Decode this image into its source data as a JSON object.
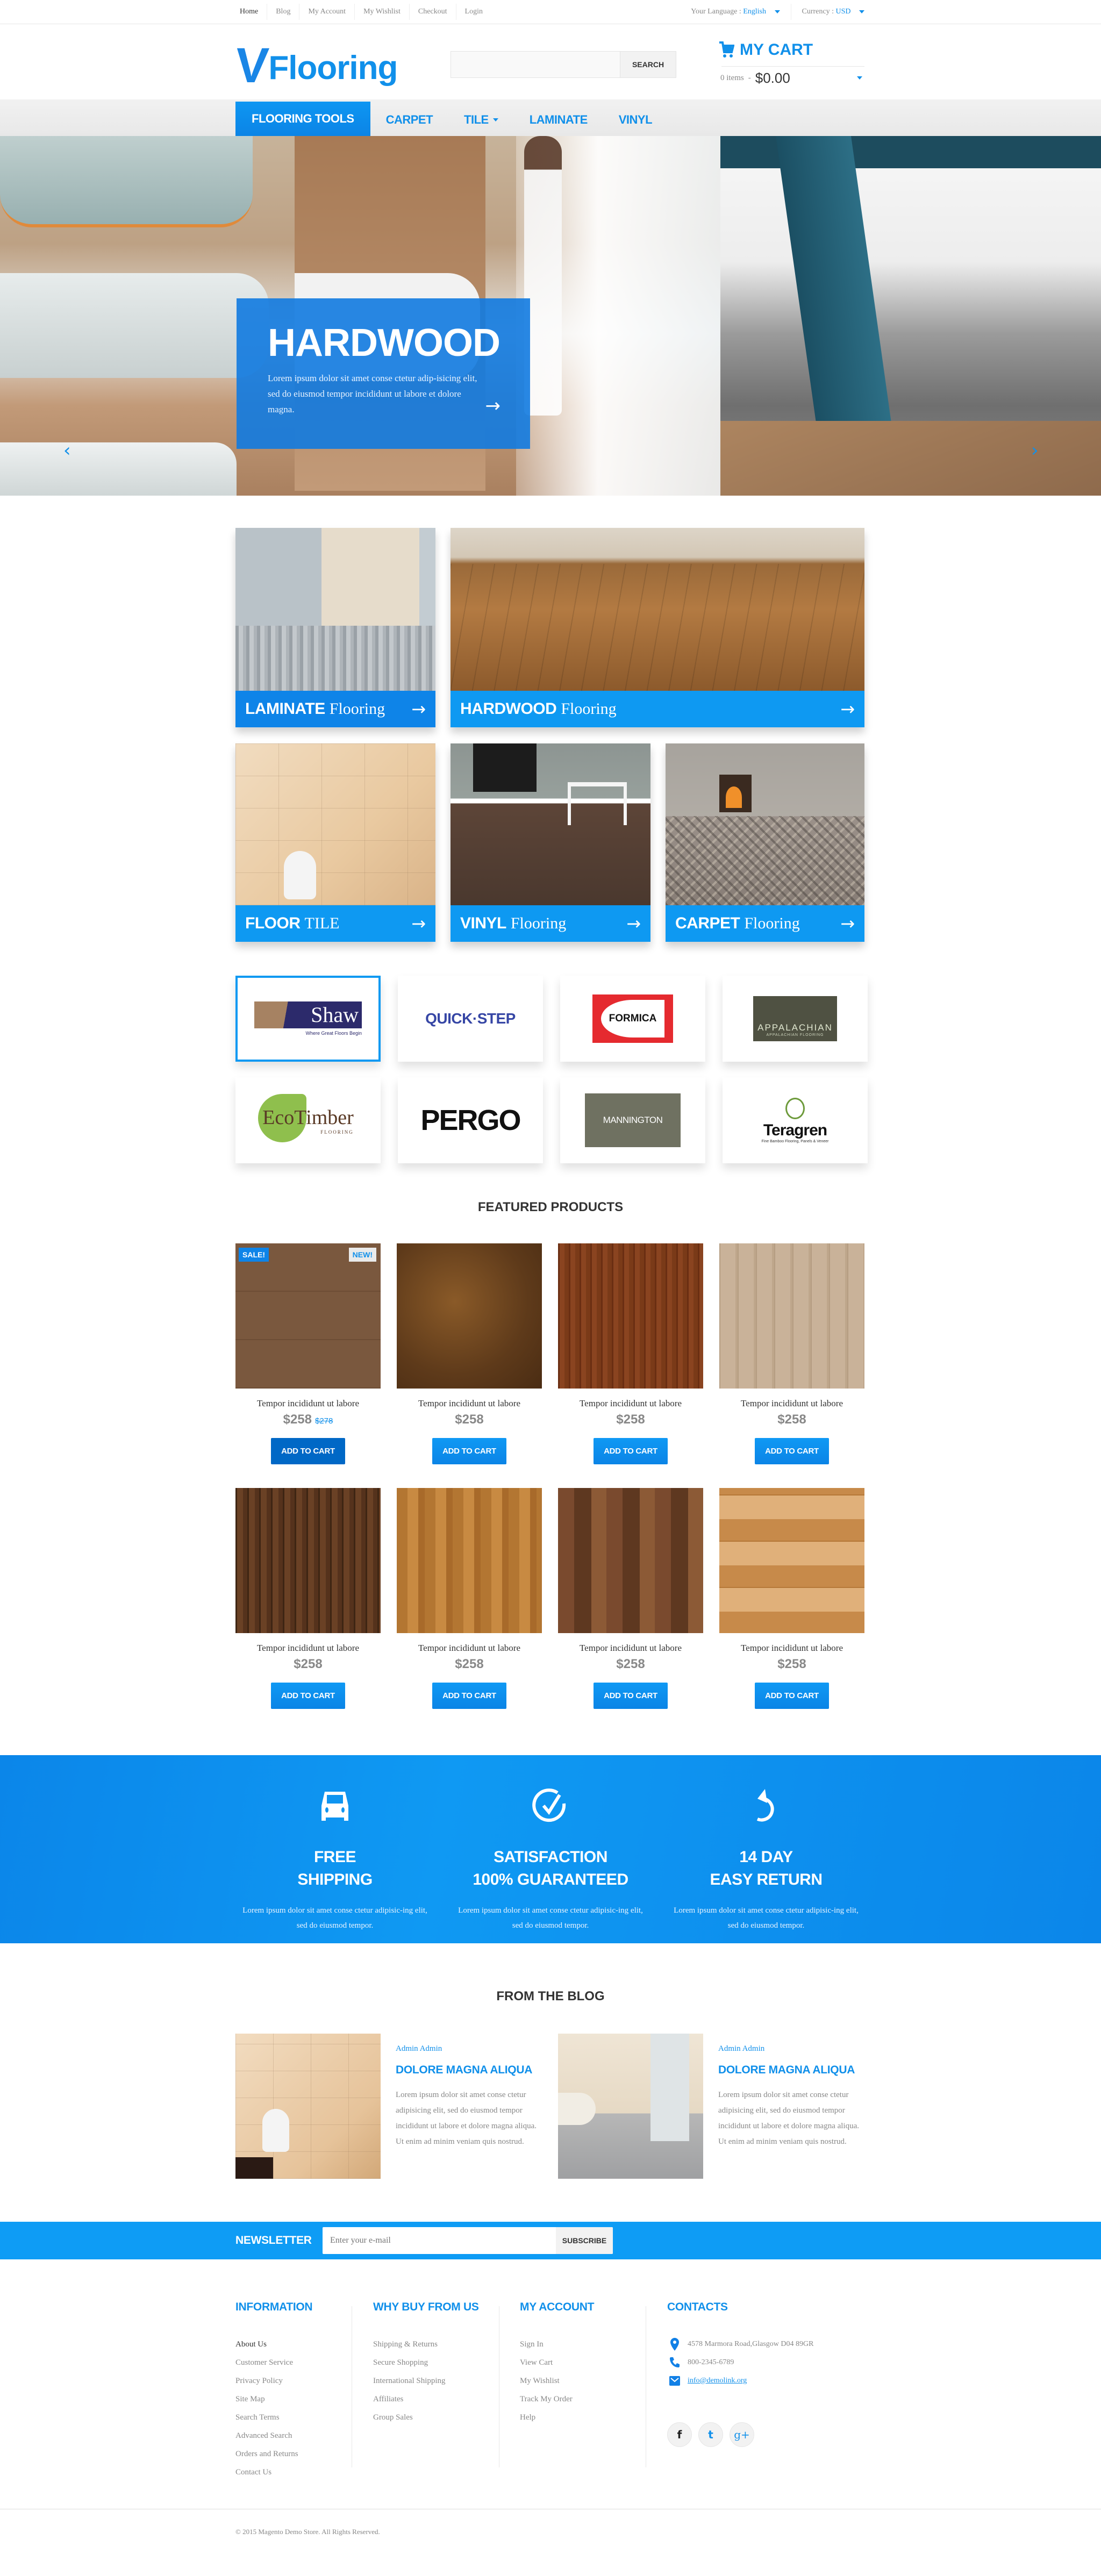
{
  "topbar": {
    "links": [
      "Home",
      "Blog",
      "My Account",
      "My Wishlist",
      "Checkout",
      "Login"
    ],
    "language_label": "Your Language :",
    "language_value": "English",
    "currency_label": "Currency :",
    "currency_value": "USD"
  },
  "header": {
    "logo_mark": "V",
    "logo_word": "Flooring",
    "search_placeholder": "",
    "search_button": "SEARCH",
    "cart_title": "MY CART",
    "cart_items": "0 items",
    "cart_separator": "-",
    "cart_total": "$0.00"
  },
  "nav": {
    "items": [
      {
        "label": "FLOORING TOOLS",
        "active": true
      },
      {
        "label": "CARPET",
        "active": false
      },
      {
        "label": "TILE",
        "active": false,
        "has_dropdown": true
      },
      {
        "label": "LAMINATE",
        "active": false
      },
      {
        "label": "VINYL",
        "active": false
      }
    ]
  },
  "hero": {
    "title": "HARDWOOD",
    "text": "Lorem ipsum dolor sit amet conse ctetur adip-isicing elit, sed do eiusmod tempor incididunt ut labore et dolore magna.",
    "prev_icon": "chevron-left",
    "next_icon": "chevron-right",
    "go_icon": "arrow-right"
  },
  "categories": [
    {
      "bold": "LAMINATE",
      "normal": "Flooring"
    },
    {
      "bold": "HARDWOOD",
      "normal": "Flooring"
    },
    {
      "bold": "FLOOR",
      "normal": "TILE"
    },
    {
      "bold": "VINYL",
      "normal": "Flooring"
    },
    {
      "bold": "CARPET",
      "normal": "Flooring"
    }
  ],
  "brands": [
    {
      "name": "Shaw",
      "tagline": "Where Great Floors Begin",
      "selected": true
    },
    {
      "name": "QUICK·STEP",
      "selected": false
    },
    {
      "name": "FORMICA",
      "selected": false
    },
    {
      "name": "APPALACHIAN",
      "tagline": "APPALACHIAN FLOORING",
      "selected": false
    },
    {
      "name": "EcoTimber",
      "tagline": "FLOORING",
      "selected": false
    },
    {
      "name": "PERGO",
      "selected": false
    },
    {
      "name": "MANNINGTON",
      "selected": false
    },
    {
      "name": "Teragren",
      "tagline": "Fine Bamboo Flooring, Panels & Veneer",
      "selected": false
    }
  ],
  "featured": {
    "title": "FEATURED PRODUCTS",
    "add_to_cart": "ADD TO CART",
    "products": [
      {
        "name": "Tempor incididunt ut labore",
        "price": "$258",
        "old_price": "$278",
        "sale_badge": "SALE!",
        "new_badge": "NEW!"
      },
      {
        "name": "Tempor incididunt ut labore",
        "price": "$258"
      },
      {
        "name": "Tempor incididunt ut labore",
        "price": "$258"
      },
      {
        "name": "Tempor incididunt ut labore",
        "price": "$258"
      },
      {
        "name": "Tempor incididunt ut labore",
        "price": "$258"
      },
      {
        "name": "Tempor incididunt ut labore",
        "price": "$258"
      },
      {
        "name": "Tempor incididunt ut labore",
        "price": "$258"
      },
      {
        "name": "Tempor incididunt ut labore",
        "price": "$258"
      }
    ]
  },
  "features": [
    {
      "icon": "car-icon",
      "line1": "FREE",
      "line2": "SHIPPING",
      "text": "Lorem ipsum dolor sit amet conse ctetur adipisic-ing elit, sed do eiusmod tempor."
    },
    {
      "icon": "check-circle-icon",
      "line1": "SATISFACTION",
      "line2": "100% GUARANTEED",
      "text": "Lorem ipsum dolor sit amet conse ctetur adipisic-ing elit, sed do eiusmod tempor."
    },
    {
      "icon": "undo-icon",
      "line1": "14 DAY",
      "line2": "EASY RETURN",
      "text": "Lorem ipsum dolor sit amet conse ctetur adipisic-ing elit, sed do eiusmod tempor."
    }
  ],
  "blog": {
    "title": "FROM THE BLOG",
    "posts": [
      {
        "author": "Admin Admin",
        "title": "DOLORE MAGNA ALIQUA",
        "text": "Lorem ipsum dolor sit amet conse ctetur adipisicing elit, sed do eiusmod tempor incididunt ut labore et dolore magna aliqua. Ut enim ad minim veniam quis nostrud."
      },
      {
        "author": "Admin Admin",
        "title": "DOLORE MAGNA ALIQUA",
        "text": "Lorem ipsum dolor sit amet conse ctetur adipisicing elit, sed do eiusmod tempor incididunt ut labore et dolore magna aliqua. Ut enim ad minim veniam quis nostrud."
      }
    ]
  },
  "newsletter": {
    "label": "NEWSLETTER",
    "placeholder": "Enter your e-mail",
    "button": "SUBSCRIBE"
  },
  "footer": {
    "information": {
      "title": "INFORMATION",
      "items": [
        "About Us",
        "Customer Service",
        "Privacy Policy",
        "Site Map",
        "Search Terms",
        "Advanced Search",
        "Orders and Returns",
        "Contact Us"
      ]
    },
    "why_buy": {
      "title": "WHY BUY FROM US",
      "items": [
        "Shipping & Returns",
        "Secure Shopping",
        "International Shipping",
        "Affiliates",
        "Group Sales"
      ]
    },
    "account": {
      "title": "MY ACCOUNT",
      "items": [
        "Sign In",
        "View Cart",
        "My Wishlist",
        "Track My Order",
        "Help"
      ]
    },
    "contacts": {
      "title": "CONTACTS",
      "address": "4578 Marmora Road,Glasgow D04 89GR",
      "phone": "800-2345-6789",
      "email": "info@demolink.org"
    },
    "social": [
      "f",
      "t",
      "g+"
    ],
    "copyright": "© 2015 Magento Demo Store. All Rights Reserved."
  },
  "colors": {
    "accent": "#1190ea",
    "accent_dark": "#0b84e6",
    "text": "#555555",
    "muted": "#888888"
  }
}
